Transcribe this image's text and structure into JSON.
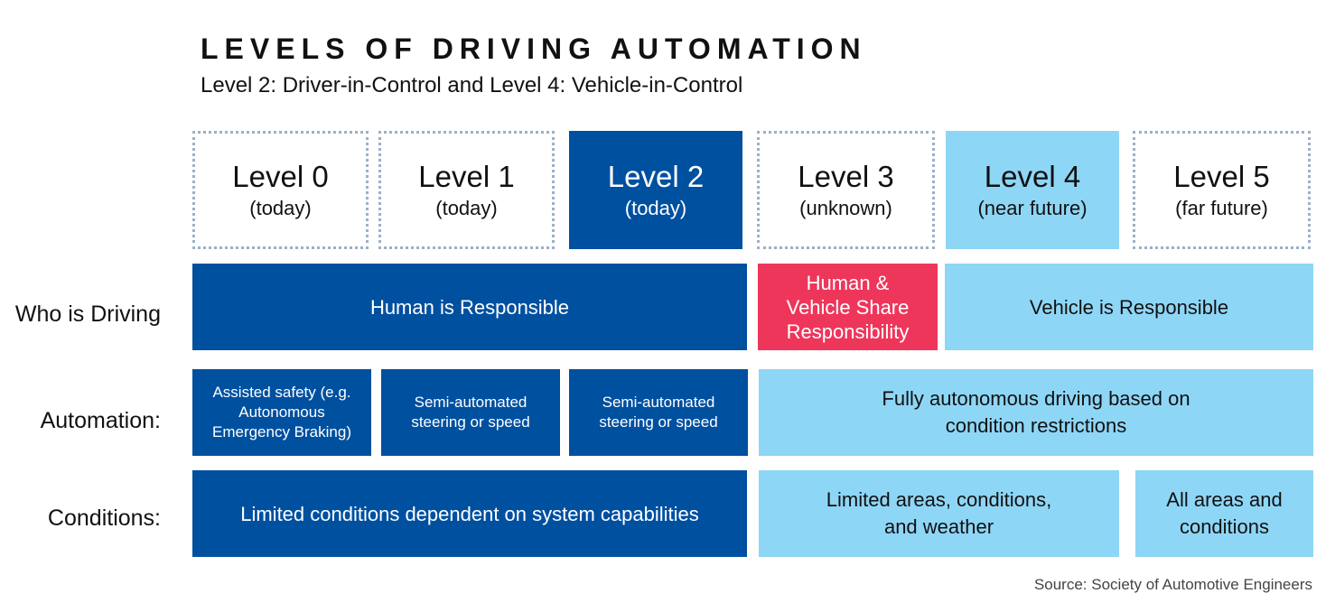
{
  "header": {
    "title": "LEVELS OF DRIVING AUTOMATION",
    "subtitle": "Level 2: Driver-in-Control and Level 4: Vehicle-in-Control"
  },
  "levels": [
    {
      "name": "Level 0",
      "when": "(today)",
      "style": "dotted"
    },
    {
      "name": "Level 1",
      "when": "(today)",
      "style": "dotted"
    },
    {
      "name": "Level 2",
      "when": "(today)",
      "style": "dark"
    },
    {
      "name": "Level 3",
      "when": "(unknown)",
      "style": "dotted"
    },
    {
      "name": "Level 4",
      "when": "(near future)",
      "style": "light"
    },
    {
      "name": "Level 5",
      "when": "(far future)",
      "style": "dotted"
    }
  ],
  "rows": {
    "who_is_driving": {
      "label": "Who is Driving",
      "cells": [
        {
          "text": "Human is Responsible",
          "levels": "0-2"
        },
        {
          "text": "Human & Vehicle Share Responsibility",
          "levels": "3"
        },
        {
          "text": "Vehicle is Responsible",
          "levels": "4-5"
        }
      ]
    },
    "automation": {
      "label": "Automation:",
      "cells": [
        {
          "text": "Assisted safety (e.g. Autonomous Emergency Braking)",
          "levels": "0"
        },
        {
          "text": "Semi-automated steering or speed",
          "levels": "1"
        },
        {
          "text": "Semi-automated steering or speed",
          "levels": "2"
        },
        {
          "text": "Fully autonomous driving based on condition restrictions",
          "levels": "3-5"
        }
      ]
    },
    "conditions": {
      "label": "Conditions:",
      "cells": [
        {
          "text": "Limited conditions dependent on system capabilities",
          "levels": "0-2"
        },
        {
          "text": "Limited areas, conditions, and weather",
          "levels": "3-4"
        },
        {
          "text": "All areas and conditions",
          "levels": "5"
        }
      ]
    }
  },
  "source": "Source: Society of Automotive Engineers",
  "colors": {
    "dark_blue": "#0050a0",
    "light_blue": "#8ed6f6",
    "red": "#ee365b",
    "dotted_border": "#9bb0c9"
  }
}
